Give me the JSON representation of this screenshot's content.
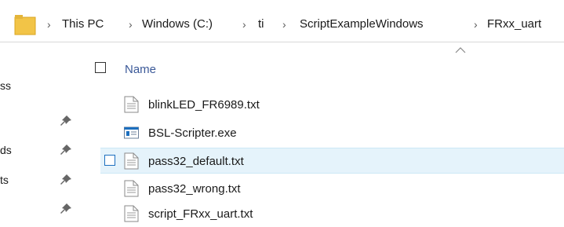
{
  "address_bar": {
    "breadcrumbs": [
      "This PC",
      "Windows (C:)",
      "ti",
      "ScriptExampleWindows",
      "FRxx_uart"
    ],
    "separator": "›"
  },
  "nav_pane": {
    "labels": [
      "ss",
      "ds",
      "ts"
    ],
    "pinned_icon": "pin-icon"
  },
  "file_list": {
    "column_header": "Name",
    "sort_indicator": "sort-ascending-icon",
    "files": [
      {
        "name": "blinkLED_FR6989.txt",
        "type": "text-file-icon"
      },
      {
        "name": "BSL-Scripter.exe",
        "type": "exe-icon"
      },
      {
        "name": "pass32_default.txt",
        "type": "text-file-icon",
        "hovered": true
      },
      {
        "name": "pass32_wrong.txt",
        "type": "text-file-icon"
      },
      {
        "name": "script_FRxx_uart.txt",
        "type": "text-file-icon"
      }
    ]
  },
  "colors": {
    "folder": "#f2c447",
    "selection_bg": "#e5f3fb",
    "header_text": "#3b5998",
    "exe_icon": "#1c6fbf"
  }
}
